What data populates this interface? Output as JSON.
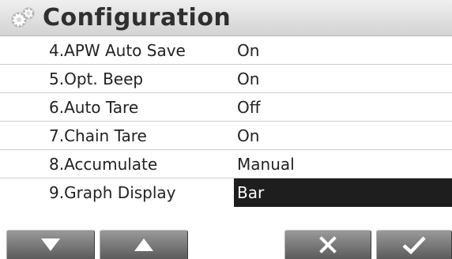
{
  "header": {
    "title": "Configuration",
    "icon": "gear-icon"
  },
  "rows": [
    {
      "label": "4.APW Auto Save",
      "value": "On"
    },
    {
      "label": "5.Opt. Beep",
      "value": "On"
    },
    {
      "label": "6.Auto Tare",
      "value": "Off"
    },
    {
      "label": "7.Chain Tare",
      "value": "On"
    },
    {
      "label": "8.Accumulate",
      "value": "Manual"
    },
    {
      "label": "9.Graph Display",
      "value": "Bar",
      "selected": true
    }
  ],
  "footer": {
    "buttons": [
      {
        "name": "down",
        "icon": "triangle-down-icon"
      },
      {
        "name": "up",
        "icon": "triangle-up-icon"
      },
      {
        "name": "cancel",
        "icon": "x-icon"
      },
      {
        "name": "accept",
        "icon": "checkmark-icon"
      }
    ]
  },
  "colors": {
    "header_bg": "#dedede",
    "selected_bg": "#1e1e1e",
    "button_bg": "#7a7a7a"
  }
}
